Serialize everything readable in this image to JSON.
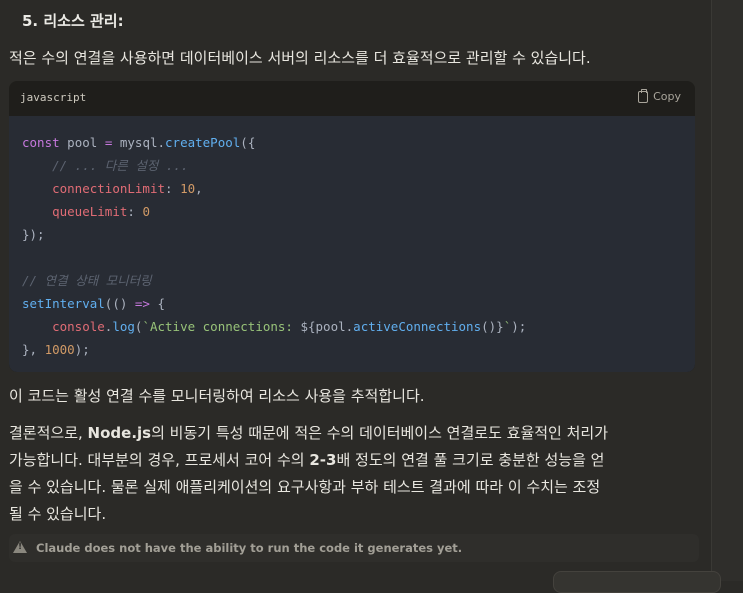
{
  "heading": "5. 리소스 관리:",
  "intro": "적은 수의 연결을 사용하면 데이터베이스 서버의 리소스를 더 효율적으로 관리할 수 있습니다.",
  "code": {
    "language": "javascript",
    "copy_label": "Copy"
  },
  "after_code": "이 코드는 활성 연결 수를 모니터링하여 리소스 사용을 추적합니다.",
  "conclusion": {
    "l1a": "결론적으로, ",
    "l1b": "Node.js",
    "l1c": "의 비동기 특성 때문에 적은 수의 데이터베이스 연결로도 효율적인 처리가",
    "l2a": "가능합니다. 대부분의 경우, 프로세서 코어 수의 ",
    "l2b": "2-3",
    "l2c": "배 정도의 연결 풀 크기로 충분한 성능을 얻",
    "l3": "을 수 있습니다. 물론 실제 애플리케이션의 요구사항과 부하 테스트 결과에 따라 이 수치는 조정",
    "l4": "될 수 있습니다."
  },
  "disclaimer": "Claude does not have the ability to run the code it generates yet."
}
